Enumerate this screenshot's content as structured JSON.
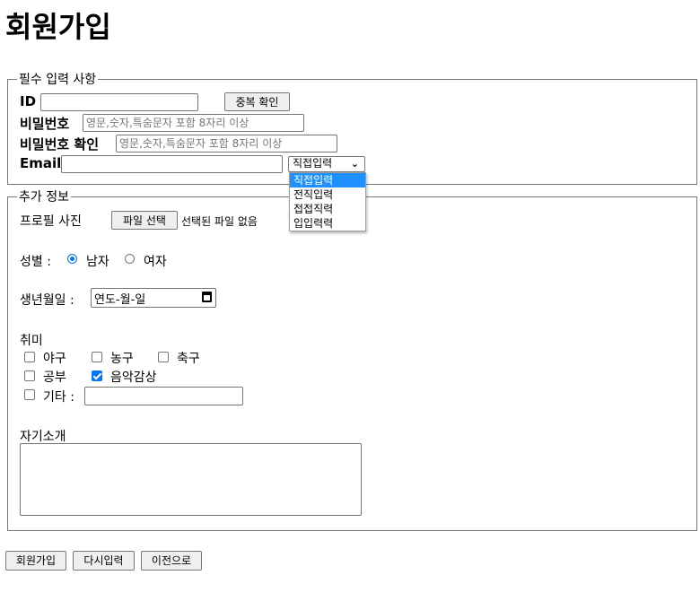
{
  "page_title": "회원가입",
  "required": {
    "legend": "필수 입력 사항",
    "id_label": "ID",
    "id_value": "",
    "dup_check": "중복 확인",
    "pw_label": "비밀번호",
    "pw_placeholder": "영문,숫자,특숨문자 포함 8자리 이상",
    "pw_confirm_label": "비밀번호 확인",
    "pw_confirm_placeholder": "영문,숫자,특숨문자 포함 8자리 이상",
    "email_label": "Email",
    "email_value": "",
    "email_select": "직접입력",
    "email_options": [
      "직접입력",
      "전직입력",
      "접접직력",
      "입입력력"
    ]
  },
  "extra": {
    "legend": "추가 정보",
    "profile_label": "프로필 사진",
    "file_button": "파일 선택",
    "file_status": "선택된 파일 없음",
    "gender_label": "성별 :",
    "gender_male": "남자",
    "gender_female": "여자",
    "gender_selected": "남자",
    "birth_label": "생년월일 :",
    "birth_placeholder": "연도-월-일",
    "hobby_label": "취미",
    "hobbies": [
      {
        "label": "야구",
        "checked": false
      },
      {
        "label": "농구",
        "checked": false
      },
      {
        "label": "축구",
        "checked": false
      },
      {
        "label": "공부",
        "checked": false
      },
      {
        "label": "음악감상",
        "checked": true
      },
      {
        "label": "기타 :",
        "checked": false
      }
    ],
    "intro_label": "자기소개"
  },
  "buttons": {
    "submit": "회원가입",
    "reset": "다시입력",
    "back": "이전으로"
  },
  "colors": {
    "accent": "#0075ff",
    "dropdown_highlight": "#1e90ff"
  }
}
